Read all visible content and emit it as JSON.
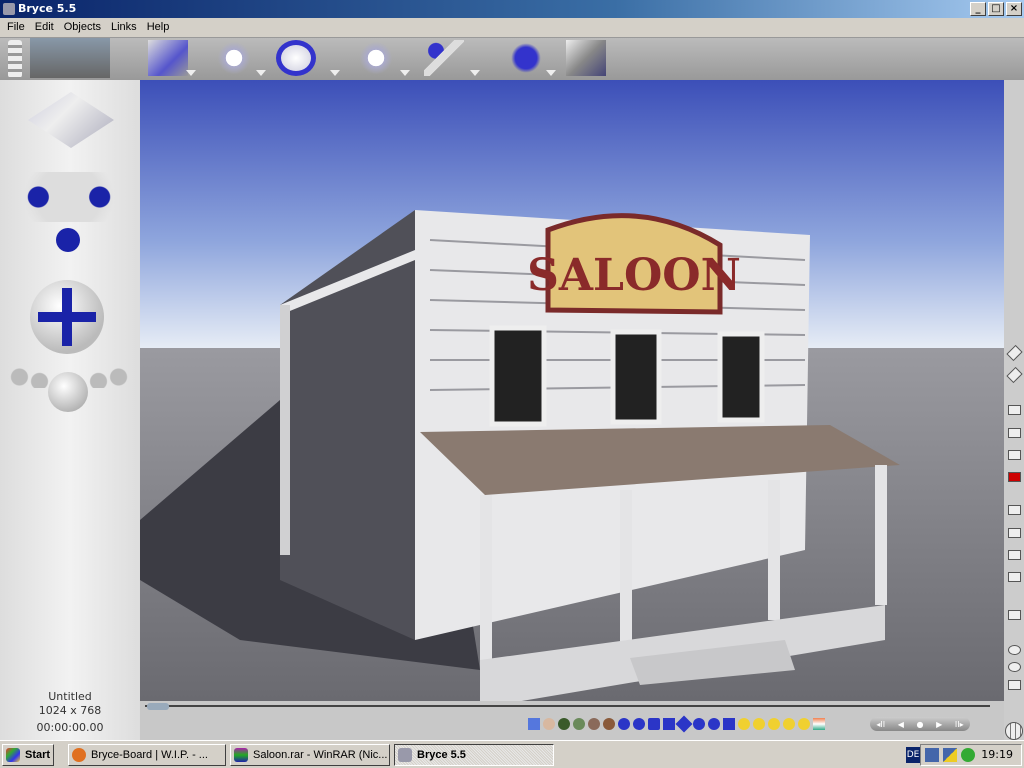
{
  "window": {
    "title": "Bryce 5.5",
    "controls": [
      "_",
      "□",
      "×"
    ]
  },
  "menu": [
    "File",
    "Edit",
    "Objects",
    "Links",
    "Help"
  ],
  "scene": {
    "sign_text": "SALOON"
  },
  "document": {
    "name": "Untitled",
    "resolution": "1024 x 768",
    "time": "00:00:00.00"
  },
  "animation_controls": [
    "◂II",
    "◀",
    "●",
    "▶",
    "II▸"
  ],
  "taskbar": {
    "start": "Start",
    "items": [
      "Bryce-Board | W.I.P. - ...",
      "Saloon.rar - WinRAR (Nic...",
      "Bryce 5.5"
    ],
    "language": "DE",
    "clock": "19:19"
  }
}
